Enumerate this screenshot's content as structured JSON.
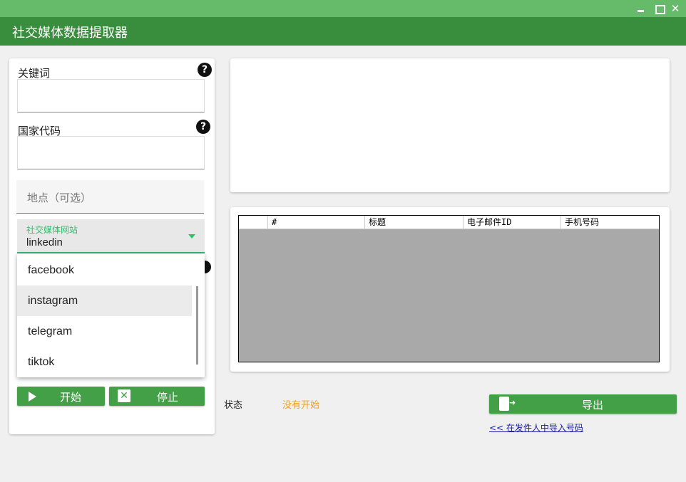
{
  "window": {
    "title": "社交媒体数据提取器",
    "minimize_glyph": "",
    "maximize_glyph": "",
    "close_glyph": "✕"
  },
  "form": {
    "keyword_label": "关键词",
    "keyword_value": "",
    "country_label": "国家代码",
    "country_value": "",
    "location_placeholder": "地点（可选）",
    "site_label": "社交媒体网站",
    "site_value": "linkedin",
    "help_glyph": "?"
  },
  "dropdown": {
    "options": [
      "facebook",
      "instagram",
      "telegram",
      "tiktok"
    ],
    "highlighted": "instagram"
  },
  "buttons": {
    "start": "开始",
    "stop": "停止",
    "stop_icon_glyph": "✕",
    "export": "导出"
  },
  "table": {
    "columns": [
      "",
      "#",
      "标题",
      "电子邮件ID",
      "手机号码"
    ],
    "rows": []
  },
  "status": {
    "label": "状态",
    "value": "没有开始"
  },
  "import_link": "<< 在发件人中导入号码",
  "colors": {
    "title_bar": "#66bb6a",
    "header": "#388e3c",
    "button": "#43a047",
    "accent_green": "#2ebf6a",
    "status_orange": "#f0a020",
    "grid_bg": "#a9a9a9"
  },
  "icons": [
    "help-icon",
    "play-icon",
    "close-box-icon",
    "export-icon",
    "dropdown-caret-icon"
  ]
}
